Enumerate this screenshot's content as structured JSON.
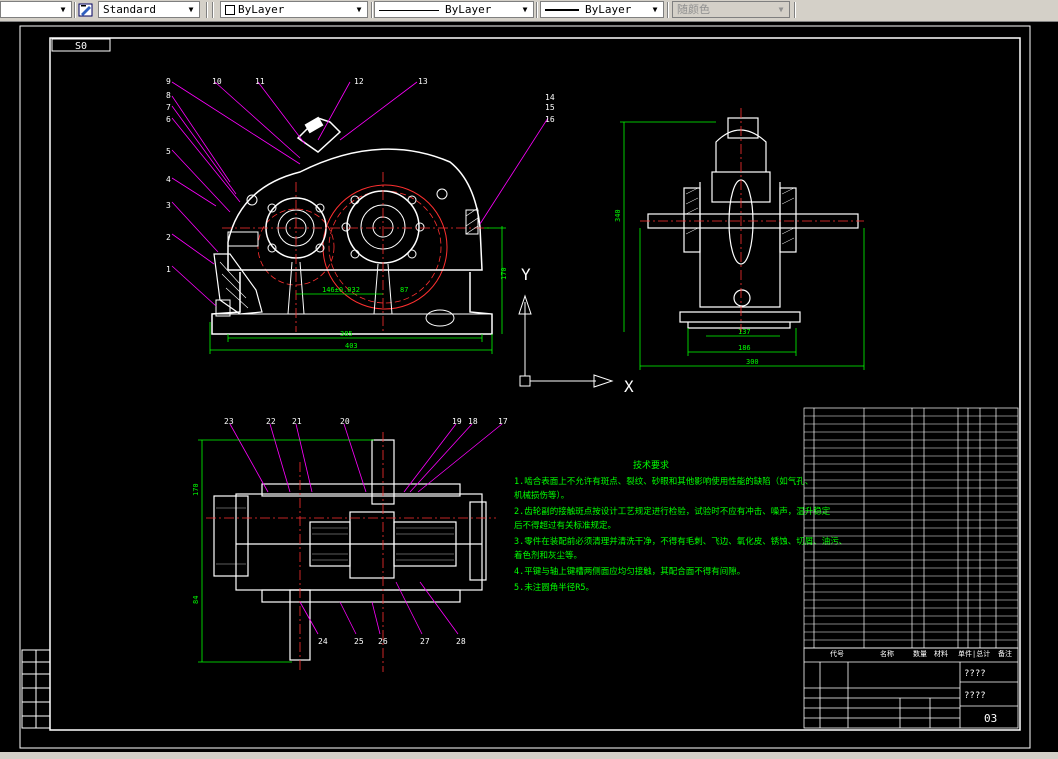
{
  "toolbar": {
    "textstyle_value": "Standard",
    "layer_value": "ByLayer",
    "linetype_value": "ByLayer",
    "lineweight_value": "ByLayer",
    "color_value": "随颜色"
  },
  "drawing": {
    "corner_label": "S0",
    "top_view_balloons": [
      "1",
      "2",
      "3",
      "4",
      "5",
      "6",
      "7",
      "8",
      "9",
      "10",
      "11",
      "12",
      "13",
      "14",
      "15",
      "16"
    ],
    "top_view_dims": [
      "385",
      "403",
      "170",
      "146±0.032",
      "87"
    ],
    "side_view_dims": [
      "340",
      "137",
      "186",
      "300"
    ],
    "plan_view_balloons": [
      "17",
      "18",
      "19",
      "20",
      "21",
      "22",
      "23",
      "24",
      "25",
      "26",
      "27",
      "28"
    ],
    "plan_view_dims": [
      "170",
      "84"
    ],
    "ucs_x": "X",
    "ucs_y": "Y",
    "tech_title": "技术要求",
    "tech_items": [
      "1.啮合表面上不允许有斑点、裂纹、砂眼和其他影响使用性能的缺陷（如气孔、",
      "  机械损伤等）。",
      "2.齿轮副的接触斑点按设计工艺规定进行检验，试验时不应有冲击、噪声，温升稳定",
      "  后不得超过有关标准规定。",
      "3.零件在装配前必须清理并清洗干净，不得有毛刺、飞边、氧化皮、锈蚀、切屑、油污、",
      "  着色剂和灰尘等。",
      "4.平键与轴上键槽两侧面应均匀接触，其配合面不得有间隙。",
      "5.未注圆角半径R5。"
    ],
    "title_block_marks": [
      "????",
      "????",
      "03"
    ],
    "title_block_header": [
      "代号",
      "名称",
      "数量",
      "材料",
      "单件|总计",
      "备注"
    ]
  },
  "colors": {
    "background": "#000000",
    "outline": "#ffffff",
    "dimension": "#00ff00",
    "leader": "#ff00ff",
    "centerline": "#ff0000",
    "text_note": "#00ff00",
    "toolbar_bg": "#d4d0c8"
  }
}
